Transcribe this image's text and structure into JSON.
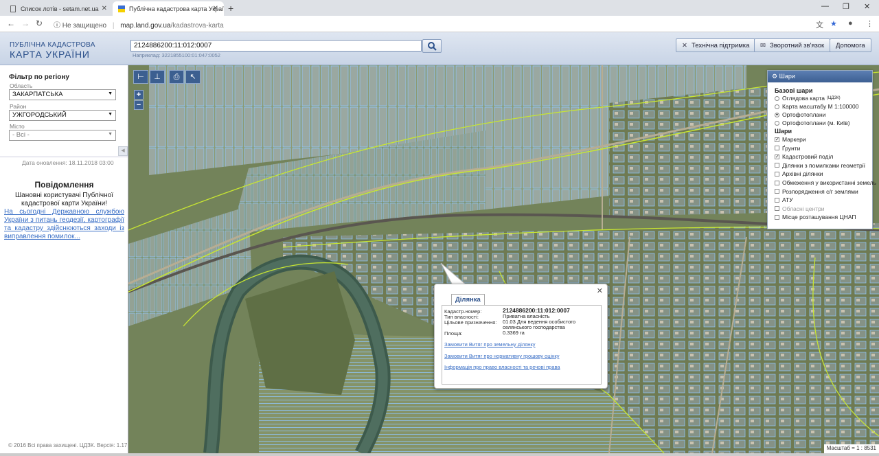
{
  "browser": {
    "tabs": [
      {
        "label": "Список лотів - setam.net.ua",
        "active": false
      },
      {
        "label": "Публічна кадастрова карта Украї",
        "active": true
      }
    ],
    "url": {
      "security": "Не защищено",
      "host": "map.land.gov.ua",
      "path": "/kadastrova-karta"
    }
  },
  "header": {
    "logo_line1": "ПУБЛІЧНА КАДАСТРОВА",
    "logo_line2": "КАРТА УКРАЇНИ",
    "search_value": "2124886200:11:012:0007",
    "search_example": "Наприклад: 3221855100:01:047:0052",
    "buttons": {
      "support": "Технічна підтримка",
      "feedback": "Зворотний зв'язок",
      "help": "Допомога"
    }
  },
  "sidebar": {
    "filter_title": "Фільтр по регіону",
    "region_label": "Область",
    "region_value": "ЗАКАРПАТСЬКА",
    "district_label": "Район",
    "district_value": "УЖГОРОДСЬКИЙ",
    "city_label": "Місто",
    "city_value": "- Всі -",
    "update_date": "Дата оновлення: 18.11.2018 03:00",
    "notice_title": "Повідомлення",
    "notice_text": "Шановні користувачі Публічної кадастрової карти України!",
    "notice_link": "На сьогодні Державною службою України з питань геодезії, картографії та кадастру здійснюються заходи із виправлення помилок...",
    "copyright": "© 2016 Всі права захищені. ЦДЗК. Версія: 1.17"
  },
  "map": {
    "zoom_in": "+",
    "zoom_out": "−",
    "scale": "Масштаб = 1 : 8531"
  },
  "layers": {
    "title": "Шари",
    "base_title": "Базові шари",
    "base": [
      {
        "label": "Оглядова карта",
        "sup": "(ЦДЗК)",
        "checked": false
      },
      {
        "label": "Карта масштабу М 1:100000",
        "checked": false
      },
      {
        "label": "Ортофотоплани",
        "checked": true
      },
      {
        "label": "Ортофотоплани (м. Київ)",
        "checked": false
      }
    ],
    "overlay_title": "Шари",
    "overlays": [
      {
        "label": "Маркери",
        "checked": true,
        "disabled": false
      },
      {
        "label": "Ґрунти",
        "checked": false,
        "disabled": false
      },
      {
        "label": "Кадастровий поділ",
        "checked": true,
        "disabled": false
      },
      {
        "label": "Ділянки з помилками геометрії",
        "checked": false,
        "disabled": false
      },
      {
        "label": "Архівні ділянки",
        "checked": false,
        "disabled": false
      },
      {
        "label": "Обмеження у використанні земель",
        "checked": false,
        "disabled": false
      },
      {
        "label": "Розпорядження с/г землями",
        "checked": false,
        "disabled": false
      },
      {
        "label": "АТУ",
        "checked": false,
        "disabled": false
      },
      {
        "label": "Обласні центри",
        "checked": false,
        "disabled": true
      },
      {
        "label": "Місце розташування ЦНАП",
        "checked": false,
        "disabled": false
      }
    ]
  },
  "popup": {
    "tab": "Ділянка",
    "fields": [
      {
        "label": "Кадастр.номер:",
        "value": "2124886200:11:012:0007"
      },
      {
        "label": "Тип власності:",
        "value": "Приватна власність"
      },
      {
        "label": "Цільове призначення:",
        "value": "01.03 Для ведення особистого селянського господарства"
      },
      {
        "label": "Площа:",
        "value": "0.3369 га"
      }
    ],
    "links": [
      "Замовити Витяг про земельну ділянку",
      "Замовити Витяг про нормативну грошову оцінку",
      "Інформація про право власності та речові права"
    ]
  },
  "colors": {
    "parcel": "#8fc8ff",
    "boundary": "#c8e632",
    "header": "#2a4f8a",
    "tool": "#3c5f90"
  }
}
